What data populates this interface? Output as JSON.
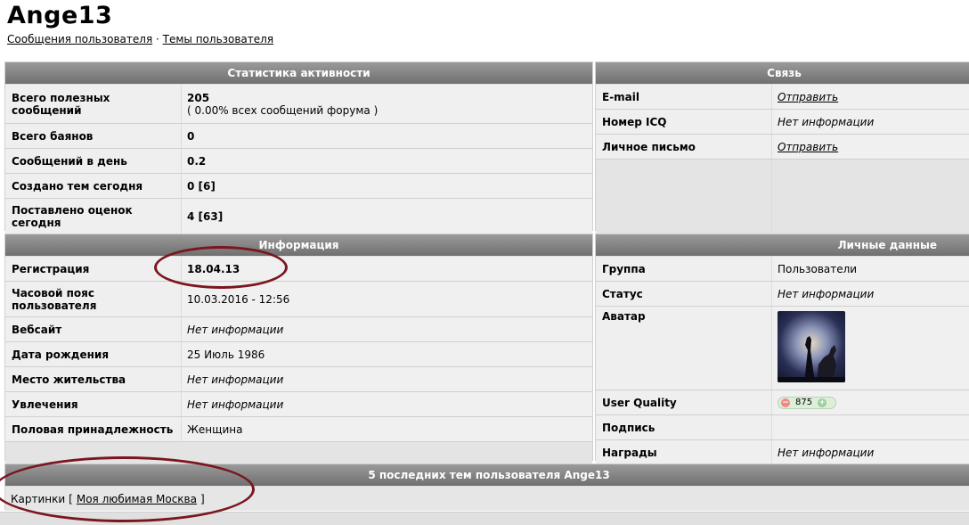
{
  "page": {
    "title": "Ange13",
    "link_messages": "Сообщения пользователя",
    "link_separator": "·",
    "link_topics": "Темы пользователя"
  },
  "stats": {
    "header": "Статистика активности",
    "rows": [
      {
        "label": "Всего полезных сообщений",
        "value": "205",
        "sub": "( 0.00% всех сообщений форума )"
      },
      {
        "label": "Всего баянов",
        "value": "0"
      },
      {
        "label": "Сообщений в день",
        "value": "0.2"
      },
      {
        "label": "Создано тем сегодня",
        "value": "0 [6]"
      },
      {
        "label": "Поставлено оценок сегодня",
        "value": "4 [63]"
      }
    ]
  },
  "contact": {
    "header": "Связь",
    "rows": [
      {
        "label": "E-mail",
        "value": "Отправить"
      },
      {
        "label": "Номер ICQ",
        "value": "Нет информации"
      },
      {
        "label": "Личное письмо",
        "value": "Отправить"
      }
    ]
  },
  "info": {
    "header": "Информация",
    "rows": [
      {
        "label": "Регистрация",
        "value": "18.04.13"
      },
      {
        "label": "Часовой пояс пользователя",
        "value": "10.03.2016 - 12:56"
      },
      {
        "label": "Вебсайт",
        "value": "Нет информации"
      },
      {
        "label": "Дата рождения",
        "value": "25 Июль 1986"
      },
      {
        "label": "Место жительства",
        "value": "Нет информации"
      },
      {
        "label": "Увлечения",
        "value": "Нет информации"
      },
      {
        "label": "Половая принадлежность",
        "value": "Женщина"
      }
    ]
  },
  "personal": {
    "header": "Личные данные",
    "rows": [
      {
        "label": "Группа",
        "value": "Пользователи"
      },
      {
        "label": "Статус",
        "value": "Нет информации"
      },
      {
        "label": "Аватар",
        "value": ""
      },
      {
        "label": "User Quality",
        "value": "875"
      },
      {
        "label": "Подпись",
        "value": ""
      },
      {
        "label": "Награды",
        "value": "Нет информации"
      }
    ],
    "quality_minus": "−",
    "quality_plus": "+"
  },
  "recent": {
    "header": "5 последних тем пользователя Ange13",
    "category": "Картинки",
    "bracket_open": "[",
    "topic": "Моя любимая Москва",
    "bracket_close": "]"
  },
  "colors": {
    "header_bg": "#808080",
    "annotation": "#7a1620"
  }
}
